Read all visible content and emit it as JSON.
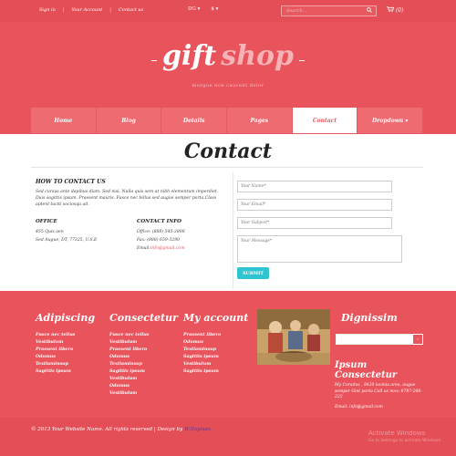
{
  "topbar": {
    "links": [
      "Sign in",
      "Your Account",
      "Contact us"
    ],
    "separator": "|",
    "currency": "DG",
    "currency_caret": "▾",
    "symbol": "$",
    "symbol_caret": "▾",
    "search_placeholder": "Search...",
    "cart_label": "(0)"
  },
  "logo": {
    "gift": "gift",
    "shop": "shop",
    "tagline": "morgue non caucent dolor"
  },
  "nav": {
    "items": [
      {
        "label": "Home"
      },
      {
        "label": "Blog"
      },
      {
        "label": "Details"
      },
      {
        "label": "Pages"
      },
      {
        "label": "Contact"
      },
      {
        "label": "Dropdown ▾"
      }
    ],
    "active_index": 4
  },
  "contact": {
    "title": "Contact",
    "howto_title": "HOW TO CONTACT US",
    "howto_text": "Sed cursus ante dapibus diam. Sed nisi. Nulla quis sem at nibh elementum imperdiet. Duis sagittis ipsum. Praesent mauris. Fusce nec tellus sed augue semper porta.Class aptent taciti sociosqu ad.",
    "office_title": "OFFICE",
    "office_lines": [
      "455 Quis aen",
      "Sed Augue, DT, 77325, U.S.E"
    ],
    "info_title": "CONTACT INFO",
    "info_office": "Office: (888) 545-3808",
    "info_fax": "Fax: (888) 659-3290",
    "info_email_label": "Email:",
    "info_email": "info@gmail.com"
  },
  "form": {
    "name_placeholder": "Your Name*",
    "email_placeholder": "Your Email*",
    "subject_placeholder": "Your Subject*",
    "message_placeholder": "Your Message*",
    "submit_label": "SUBMIT"
  },
  "footer": {
    "col1": {
      "title": "Adipiscing",
      "items": [
        "Fusce nec tellus",
        "Vestibulum",
        "Praesent libero",
        "Odomus",
        "Textlaminsup",
        "Sagittis ipsum"
      ]
    },
    "col2": {
      "title": "Consectetur",
      "items": [
        "Fusce nec tellus",
        "Vestibulum",
        "Praesent libero",
        "Odomus",
        "Textlaminsup",
        "Sagittis ipsum",
        "Vestibulum",
        "Odomus",
        "Vestibulum"
      ]
    },
    "col3": {
      "title": "My account",
      "items": [
        "Praesent libero",
        "Odomus",
        "Textlaminsup",
        "Sagittis ipsum",
        "Vestibulum",
        "Sagittis ipsum"
      ]
    },
    "col4": {
      "title": "Dignissim",
      "button": "›"
    },
    "ipsum": {
      "title": "Ipsum Consectetur",
      "text": "My Coradus , 8420 lavinia area, augue semper Gint porta Call us now: 8787-206-222",
      "email": "Email: info@gmail.com"
    }
  },
  "bottom": {
    "copyright": "© 2013 Your Website Name. All rights reserved | Design by",
    "designer": "W3layouts",
    "watermark_title": "Activate Windows",
    "watermark_sub": "Go to Settings to activate Windows."
  },
  "colors": {
    "brand": "#e9535b",
    "nav": "#ef6b72",
    "submit": "#2fc4d2"
  }
}
